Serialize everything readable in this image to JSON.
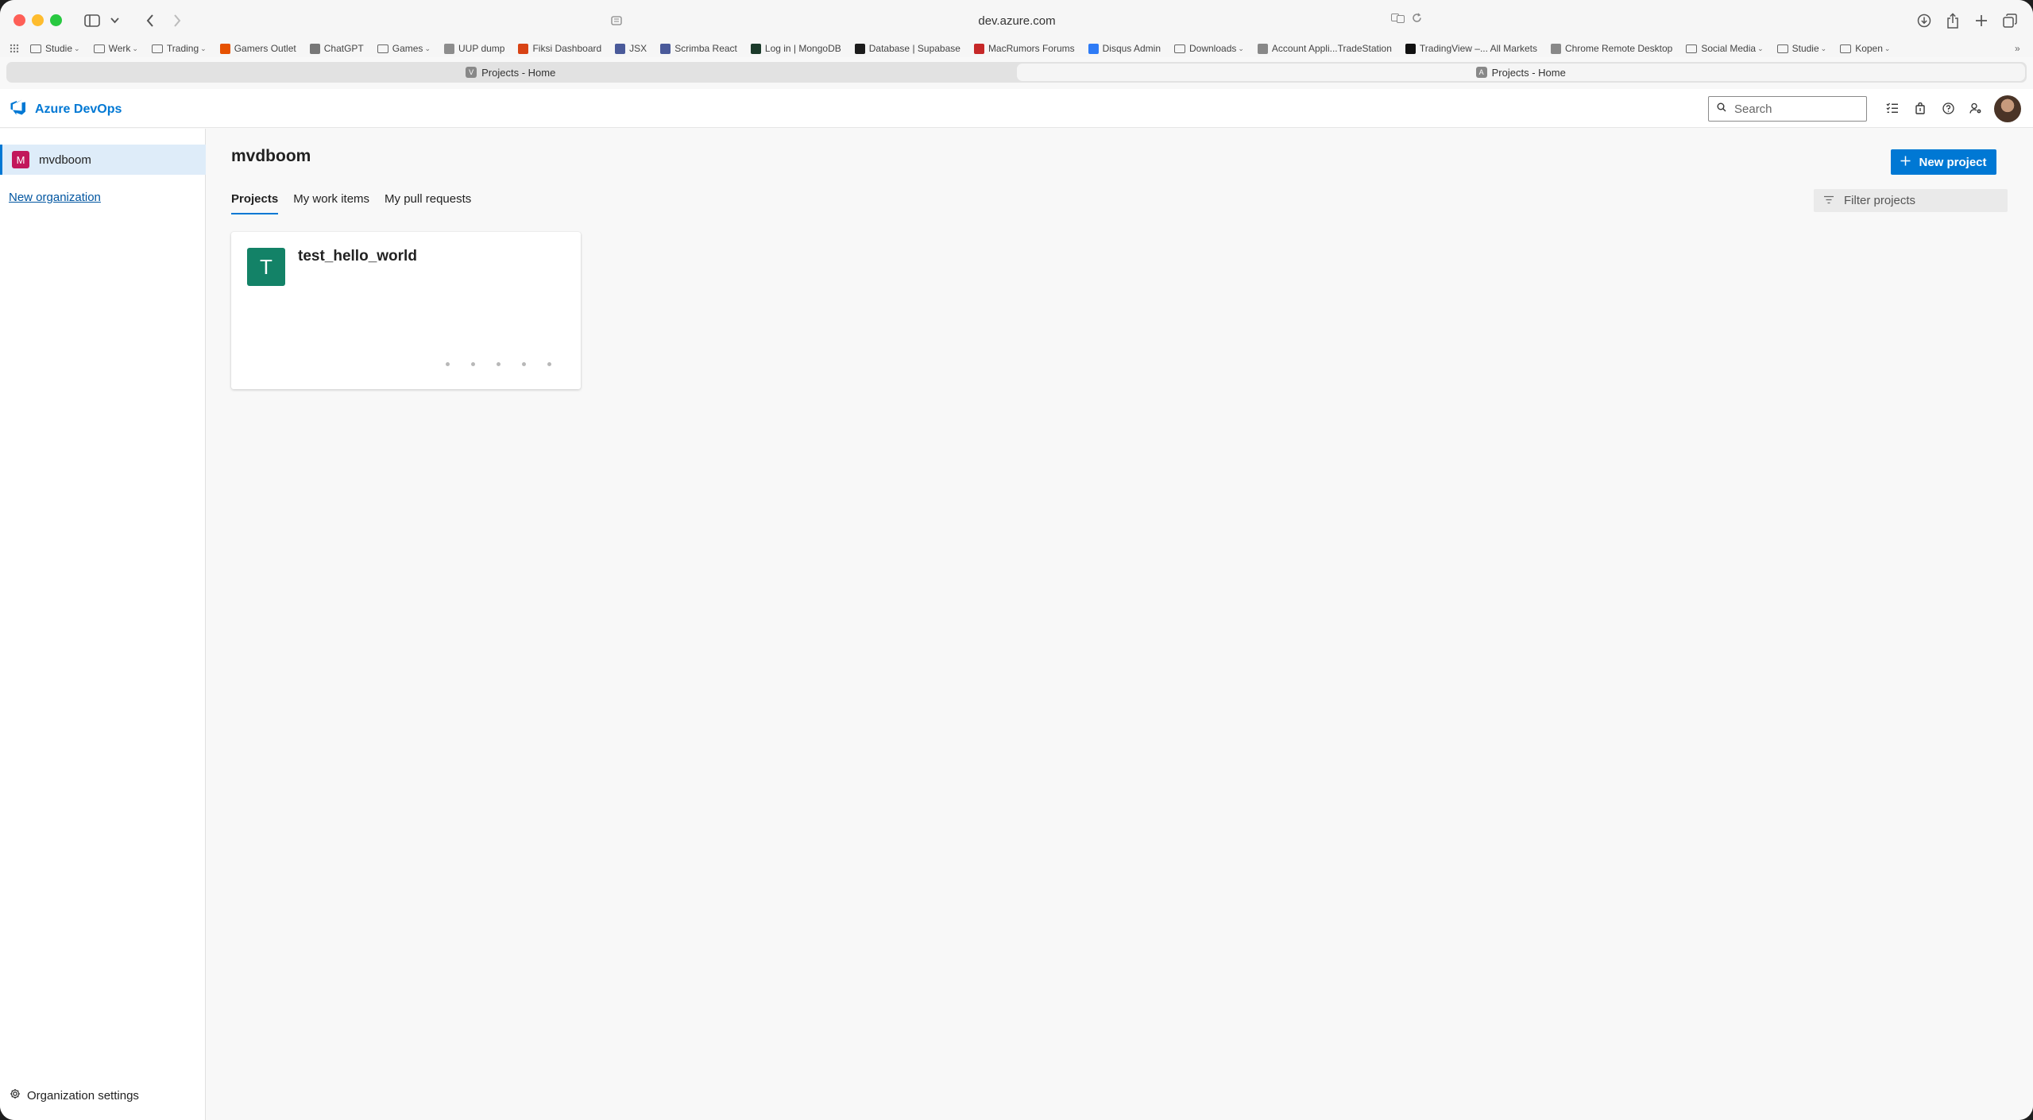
{
  "browser": {
    "url": "dev.azure.com",
    "bookmarks": [
      {
        "label": "Studie",
        "folder": true,
        "chevron": true
      },
      {
        "label": "Werk",
        "folder": true,
        "chevron": true
      },
      {
        "label": "Trading",
        "folder": true,
        "chevron": true
      },
      {
        "label": "Gamers Outlet",
        "color": "#e65100"
      },
      {
        "label": "ChatGPT",
        "color": "#777777"
      },
      {
        "label": "Games",
        "folder": true,
        "chevron": true
      },
      {
        "label": "UUP dump",
        "color": "#8d8d8d"
      },
      {
        "label": "Fiksi Dashboard",
        "color": "#d84315"
      },
      {
        "label": "JSX",
        "color": "#4a5a9a"
      },
      {
        "label": "Scrimba React",
        "color": "#4a5a9a"
      },
      {
        "label": "Log in | MongoDB",
        "color": "#1b3a2a"
      },
      {
        "label": "Database | Supabase",
        "color": "#1c1c1c"
      },
      {
        "label": "MacRumors Forums",
        "color": "#c62828"
      },
      {
        "label": "Disqus Admin",
        "color": "#2e7bf6"
      },
      {
        "label": "Downloads",
        "folder": true,
        "chevron": true
      },
      {
        "label": "Account Appli...TradeStation",
        "color": "#888888"
      },
      {
        "label": "TradingView –... All Markets",
        "color": "#111111"
      },
      {
        "label": "Chrome Remote Desktop",
        "color": "#888888"
      },
      {
        "label": "Social Media",
        "folder": true,
        "chevron": true
      },
      {
        "label": "Studie",
        "folder": true,
        "chevron": true
      },
      {
        "label": "Kopen",
        "folder": true,
        "chevron": true
      }
    ],
    "tabs": [
      {
        "label": "Projects - Home",
        "favicon": "V",
        "active": false
      },
      {
        "label": "Projects - Home",
        "favicon": "A",
        "active": true
      }
    ]
  },
  "header": {
    "brand": "Azure DevOps",
    "search_placeholder": "Search",
    "icons": [
      "work-items-list-icon",
      "marketplace-bag-icon",
      "help-icon",
      "user-settings-icon"
    ]
  },
  "sidebar": {
    "org_badge": "M",
    "org_name": "mvdboom",
    "new_org_label": "New organization",
    "settings_label": "Organization settings"
  },
  "main": {
    "title": "mvdboom",
    "new_project_label": "New project",
    "pivots": [
      "Projects",
      "My work items",
      "My pull requests"
    ],
    "filter_placeholder": "Filter projects",
    "projects": [
      {
        "badge": "T",
        "name": "test_hello_world",
        "badge_color": "#138267"
      }
    ]
  },
  "colors": {
    "accent": "#0078d4",
    "org_badge": "#c2185b",
    "project_badge": "#138267"
  }
}
